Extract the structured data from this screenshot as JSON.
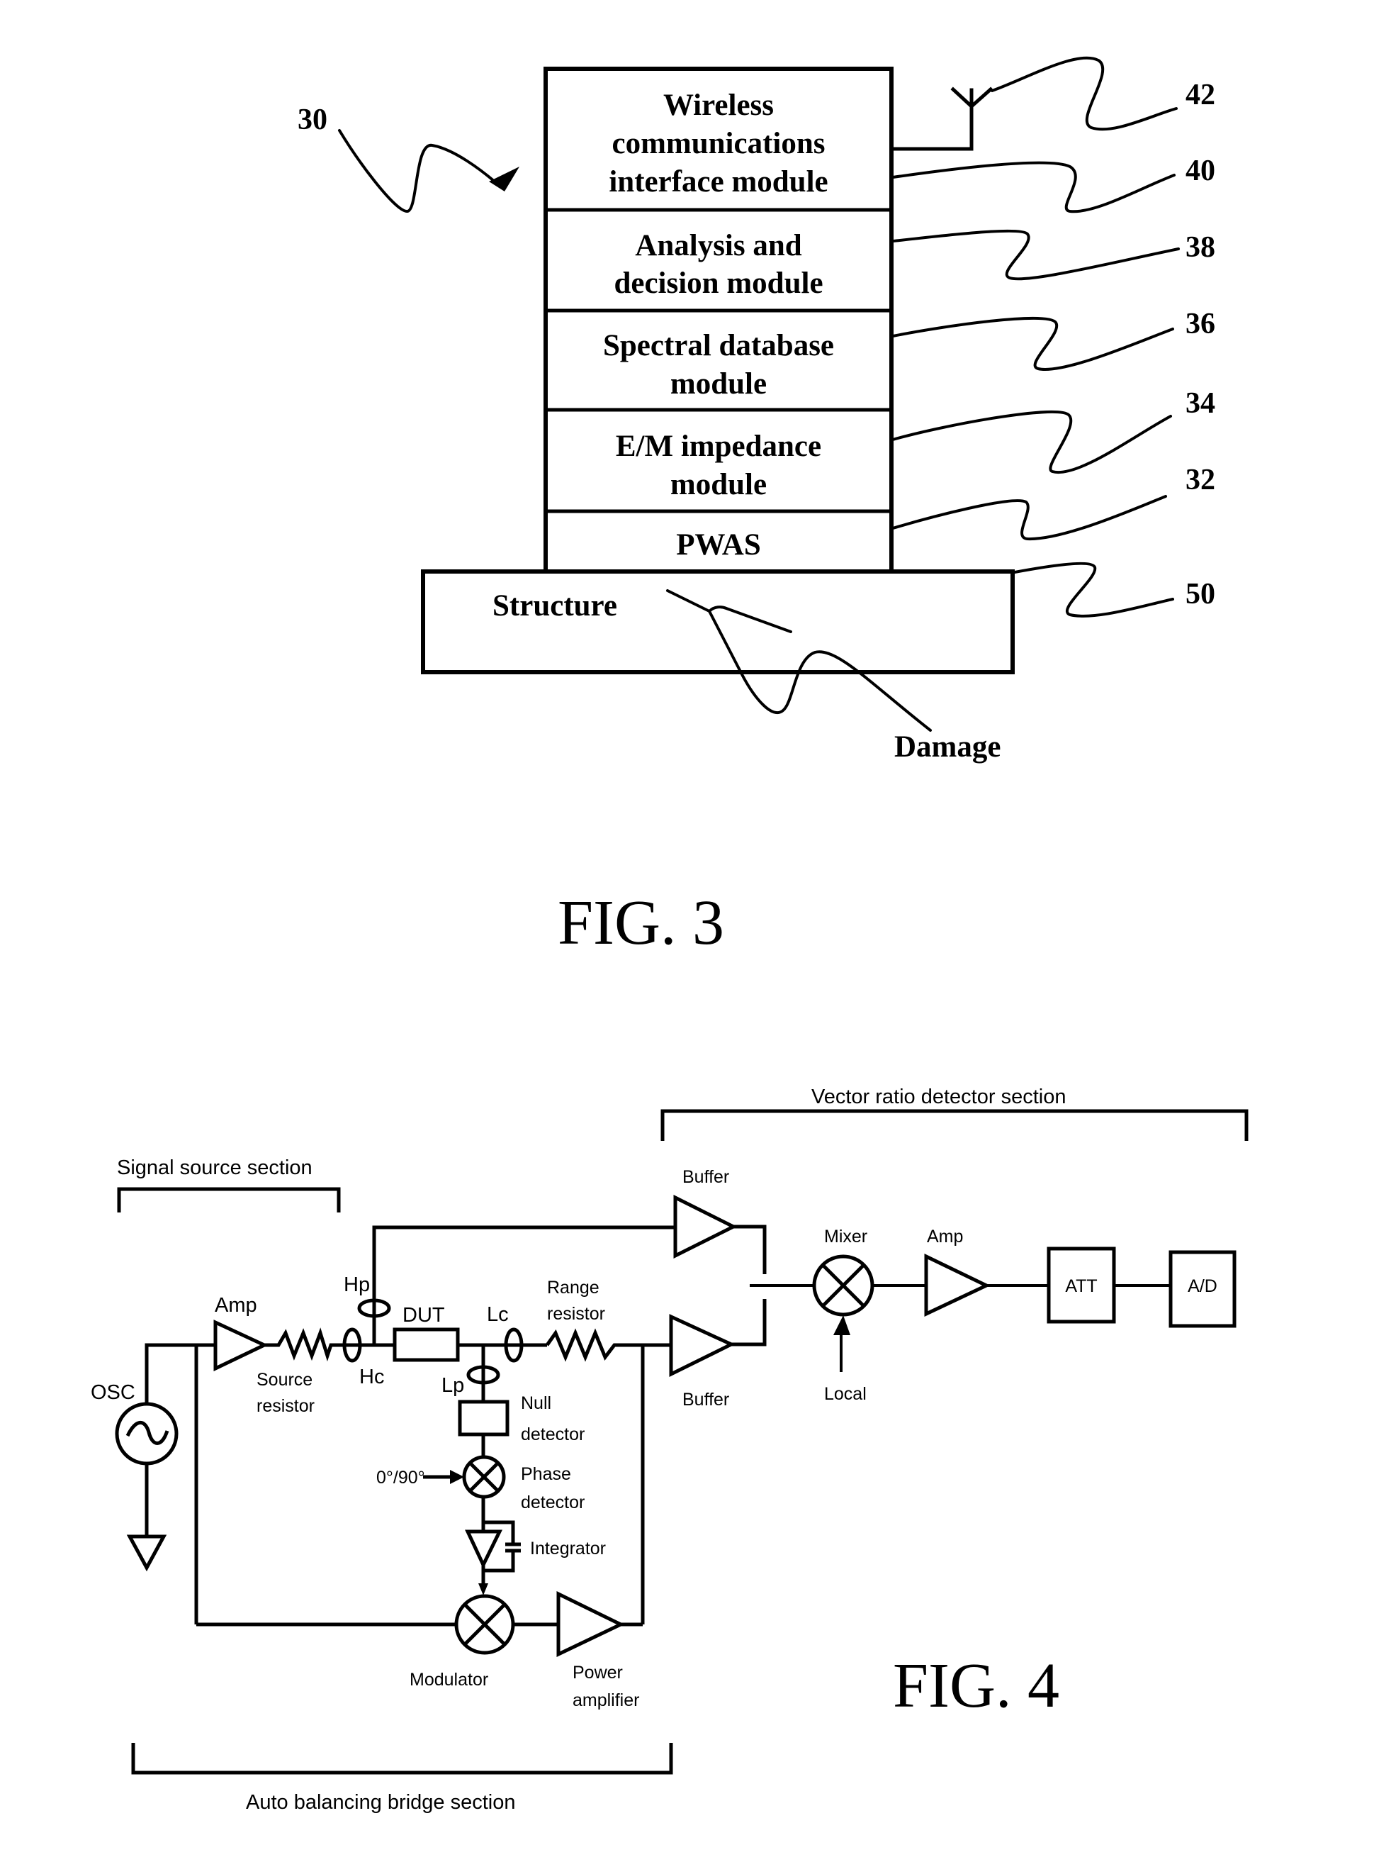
{
  "fig3": {
    "caption": "FIG. 3",
    "system_ref": "30",
    "modules": [
      {
        "lines": [
          "Wireless",
          "communications",
          "interface module"
        ],
        "ref": "40"
      },
      {
        "lines": [
          "Analysis and",
          "decision module"
        ],
        "ref": "38"
      },
      {
        "lines": [
          "Spectral database",
          "module"
        ],
        "ref": "36"
      },
      {
        "lines": [
          "E/M impedance",
          "module"
        ],
        "ref": "34"
      },
      {
        "lines": [
          "PWAS"
        ],
        "ref": "32"
      }
    ],
    "antenna_ref": "42",
    "structure": {
      "label": "Structure",
      "ref": "50"
    },
    "damage_label": "Damage"
  },
  "fig4": {
    "caption": "FIG. 4",
    "sections": {
      "signal_source": "Signal source section",
      "vector_ratio": "Vector ratio detector section",
      "auto_balancing": "Auto balancing bridge section"
    },
    "labels": {
      "osc": "OSC",
      "amp_source": "Amp",
      "source_resistor": [
        "Source",
        "resistor"
      ],
      "hp": "Hp",
      "hc": "Hc",
      "dut": "DUT",
      "lc": "Lc",
      "lp": "Lp",
      "range_resistor": [
        "Range",
        "resistor"
      ],
      "null_detector": [
        "Null",
        "detector"
      ],
      "phase_input": "0°/90°",
      "phase_detector": [
        "Phase",
        "detector"
      ],
      "integrator": "Integrator",
      "modulator": "Modulator",
      "power_amplifier": [
        "Power",
        "amplifier"
      ],
      "buffer_top": "Buffer",
      "buffer_bottom": "Buffer",
      "mixer": "Mixer",
      "local": "Local",
      "amp_detector": "Amp",
      "att": "ATT",
      "ad": "A/D"
    }
  }
}
